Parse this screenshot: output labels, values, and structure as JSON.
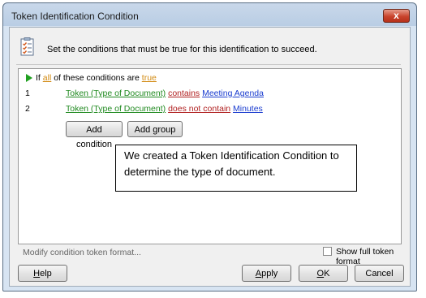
{
  "window": {
    "title": "Token Identification Condition",
    "close_glyph": "x"
  },
  "header": {
    "icon": "checklist-icon",
    "text": "Set the conditions that must be true for this identification to succeed."
  },
  "condition_root": {
    "if": "If",
    "quantifier": "all",
    "middle": "of these conditions are",
    "value": "true"
  },
  "conditions": [
    {
      "num": "1",
      "token": "Token (Type of Document)",
      "operator": "contains",
      "value": "Meeting Agenda"
    },
    {
      "num": "2",
      "token": "Token (Type of Document)",
      "operator": "does not contain",
      "value": "Minutes"
    }
  ],
  "buttons": {
    "add_condition": "Add condition",
    "add_group": "Add group",
    "help_pre": "H",
    "help_post": "elp",
    "apply_pre": "A",
    "apply_post": "pply",
    "ok_pre": "O",
    "ok_post": "K",
    "cancel": "Cancel"
  },
  "callout": {
    "text": "We created a Token Identification Condition to determine the type of document."
  },
  "footer": {
    "modify_link": "Modify condition token format...",
    "show_full_token_format": "Show full token format",
    "show_full_token_format_checked": false
  },
  "colors": {
    "orange": "#d28a12",
    "green": "#208a20",
    "red": "#b02020",
    "blue": "#1a3ccf"
  }
}
